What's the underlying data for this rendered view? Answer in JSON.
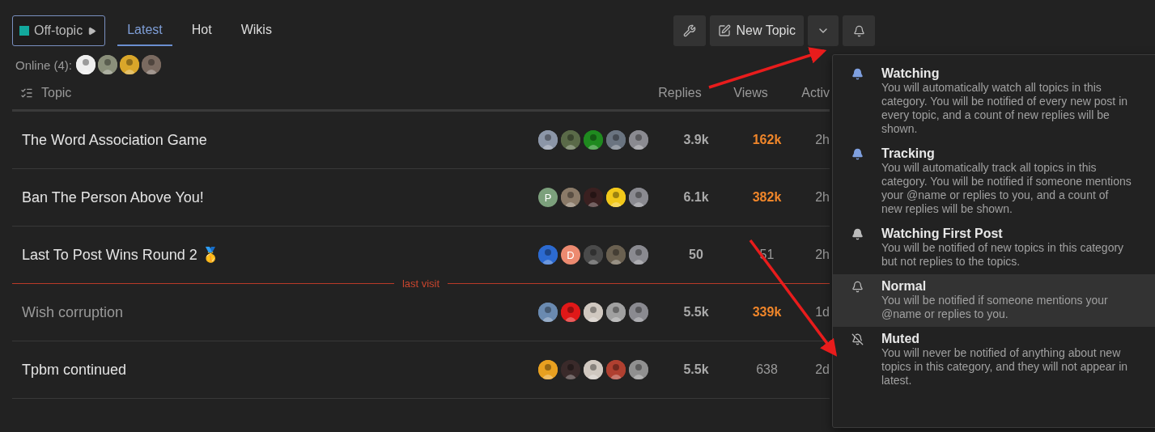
{
  "category": {
    "name": "Off-topic",
    "color": "#12a89d"
  },
  "tabs": [
    {
      "label": "Latest",
      "selected": true
    },
    {
      "label": "Hot",
      "selected": false
    },
    {
      "label": "Wikis",
      "selected": false
    }
  ],
  "toolbar": {
    "new_topic": "New Topic"
  },
  "online": {
    "label": "Online (4):",
    "avatars": [
      {
        "kind": "picture",
        "color": "#eeeeee"
      },
      {
        "kind": "picture",
        "color": "#8a8f7a"
      },
      {
        "kind": "picture",
        "color": "#d9a62a"
      },
      {
        "kind": "picture",
        "color": "#7a6a60"
      }
    ]
  },
  "columns": {
    "topic": "Topic",
    "replies": "Replies",
    "views": "Views",
    "activity": "Activ"
  },
  "topics": [
    {
      "title": "The Word Association Game",
      "visited": false,
      "replies": "3.9k",
      "views": "162k",
      "hot": true,
      "activity": "2h",
      "avatars": [
        {
          "kind": "picture",
          "color": "#8c96a8"
        },
        {
          "kind": "picture",
          "color": "#5a6a48"
        },
        {
          "kind": "picture",
          "color": "#1f8a1f"
        },
        {
          "kind": "picture",
          "color": "#6a7480"
        },
        {
          "kind": "picture",
          "color": "#8a8a90"
        }
      ]
    },
    {
      "title": "Ban The Person Above You!",
      "visited": false,
      "replies": "6.1k",
      "views": "382k",
      "hot": true,
      "activity": "2h",
      "avatars": [
        {
          "kind": "letter",
          "letter": "P",
          "color": "#7ca07c"
        },
        {
          "kind": "picture",
          "color": "#8a7a68"
        },
        {
          "kind": "picture",
          "color": "#3a2020"
        },
        {
          "kind": "picture",
          "color": "#f2c81a"
        },
        {
          "kind": "picture",
          "color": "#8a8a90"
        }
      ]
    },
    {
      "title": "Last To Post Wins Round 2 🥇",
      "visited": false,
      "replies": "50",
      "views": "51",
      "hot": false,
      "activity": "2h",
      "avatars": [
        {
          "kind": "picture",
          "color": "#2c6ad0"
        },
        {
          "kind": "letter",
          "letter": "D",
          "color": "#ec8a70"
        },
        {
          "kind": "picture",
          "color": "#4a4a4a"
        },
        {
          "kind": "picture",
          "color": "#6a6050"
        },
        {
          "kind": "picture",
          "color": "#8a8a90"
        }
      ]
    },
    {
      "title": "Wish corruption",
      "visited": true,
      "last_visit": "last visit",
      "replies": "5.5k",
      "views": "339k",
      "hot": true,
      "activity": "1d",
      "avatars": [
        {
          "kind": "picture",
          "color": "#6a8ab0"
        },
        {
          "kind": "picture",
          "color": "#e01818"
        },
        {
          "kind": "picture",
          "color": "#d0c8c0"
        },
        {
          "kind": "picture",
          "color": "#a0a0a0"
        },
        {
          "kind": "picture",
          "color": "#8a8a90"
        }
      ]
    },
    {
      "title": "Tpbm continued",
      "visited": false,
      "replies": "5.5k",
      "views": "638",
      "hot": false,
      "activity": "2d",
      "avatars": [
        {
          "kind": "picture",
          "color": "#e8a020"
        },
        {
          "kind": "picture",
          "color": "#3a2a2a"
        },
        {
          "kind": "picture",
          "color": "#d0c8c0"
        },
        {
          "kind": "picture",
          "color": "#b04030"
        },
        {
          "kind": "picture",
          "color": "#909090"
        }
      ]
    }
  ],
  "notification_menu": [
    {
      "kind": "watching",
      "title": "Watching",
      "description": "You will automatically watch all topics in this category. You will be notified of every new post in every topic, and a count of new replies will be shown.",
      "selected": false
    },
    {
      "kind": "tracking",
      "title": "Tracking",
      "description": "You will automatically track all topics in this category. You will be notified if someone mentions your @name or replies to you, and a count of new replies will be shown.",
      "selected": false
    },
    {
      "kind": "watching_first",
      "title": "Watching First Post",
      "description": "You will be notified of new topics in this category but not replies to the topics.",
      "selected": false
    },
    {
      "kind": "normal",
      "title": "Normal",
      "description": "You will be notified if someone mentions your @name or replies to you.",
      "selected": true
    },
    {
      "kind": "muted",
      "title": "Muted",
      "description": "You will never be notified of anything about new topics in this category, and they will not appear in latest.",
      "selected": false
    }
  ]
}
